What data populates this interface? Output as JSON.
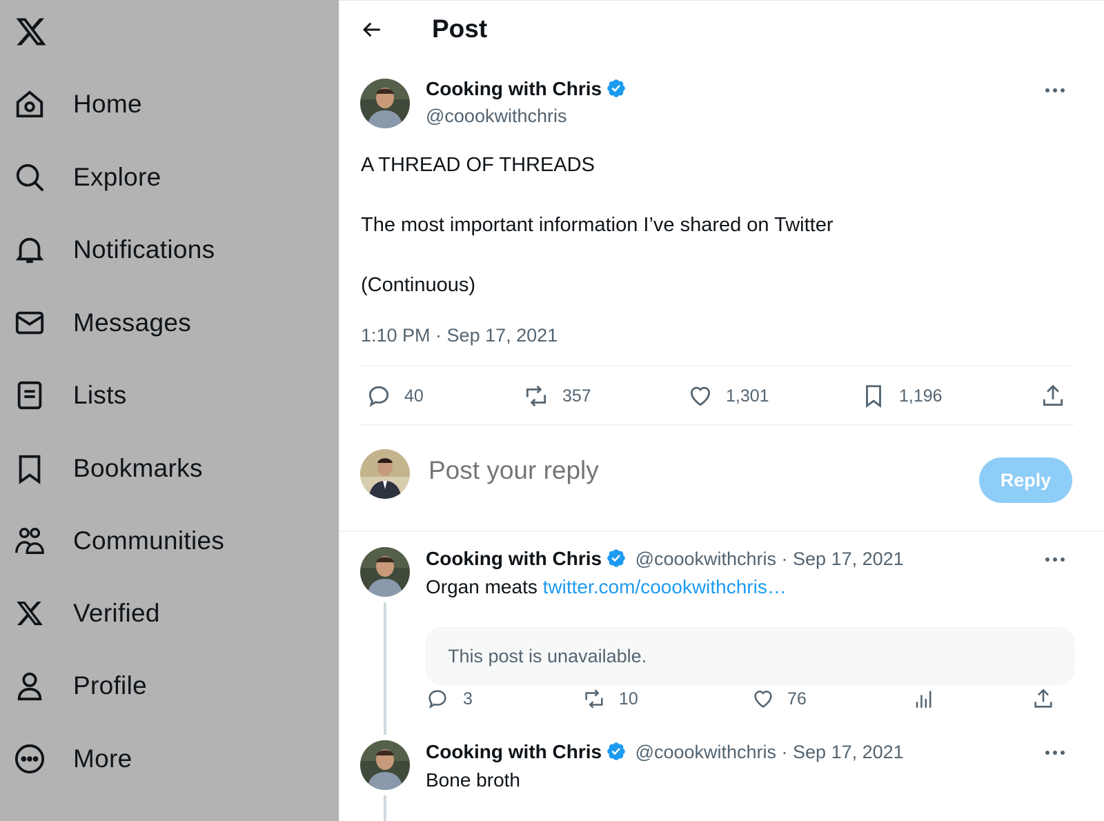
{
  "sidebar": {
    "items": [
      {
        "label": "Home",
        "icon": "home-icon"
      },
      {
        "label": "Explore",
        "icon": "search-icon"
      },
      {
        "label": "Notifications",
        "icon": "bell-icon"
      },
      {
        "label": "Messages",
        "icon": "envelope-icon"
      },
      {
        "label": "Lists",
        "icon": "list-icon"
      },
      {
        "label": "Bookmarks",
        "icon": "bookmark-icon"
      },
      {
        "label": "Communities",
        "icon": "communities-icon"
      },
      {
        "label": "Verified",
        "icon": "x-logo-icon"
      },
      {
        "label": "Profile",
        "icon": "profile-icon"
      },
      {
        "label": "More",
        "icon": "more-circle-icon"
      }
    ]
  },
  "header": {
    "title": "Post"
  },
  "post": {
    "author_name": "Cooking with Chris",
    "author_handle": "@coookwithchris",
    "line1": "A THREAD OF THREADS",
    "line2": "The most important information I’ve shared on Twitter",
    "line3": "(Continuous)",
    "timestamp": "1:10 PM · Sep 17, 2021",
    "stats": {
      "replies": "40",
      "reposts": "357",
      "likes": "1,301",
      "bookmarks": "1,196"
    }
  },
  "reply_box": {
    "placeholder": "Post your reply",
    "button_label": "Reply"
  },
  "replies": [
    {
      "author_name": "Cooking with Chris",
      "meta": "@coookwithchris · Sep 17, 2021",
      "text": "Organ meats ",
      "link": "twitter.com/coookwithchris…",
      "unavailable": "This post is unavailable.",
      "stats": {
        "replies": "3",
        "reposts": "10",
        "likes": "76"
      }
    },
    {
      "author_name": "Cooking with Chris",
      "meta": "@coookwithchris · Sep 17, 2021",
      "text": "Bone broth"
    }
  ],
  "colors": {
    "accent": "#1d9bf0",
    "sidebar_bg": "#b3b3b3",
    "reply_button": "#8ecdf7",
    "muted_text": "#536471"
  }
}
